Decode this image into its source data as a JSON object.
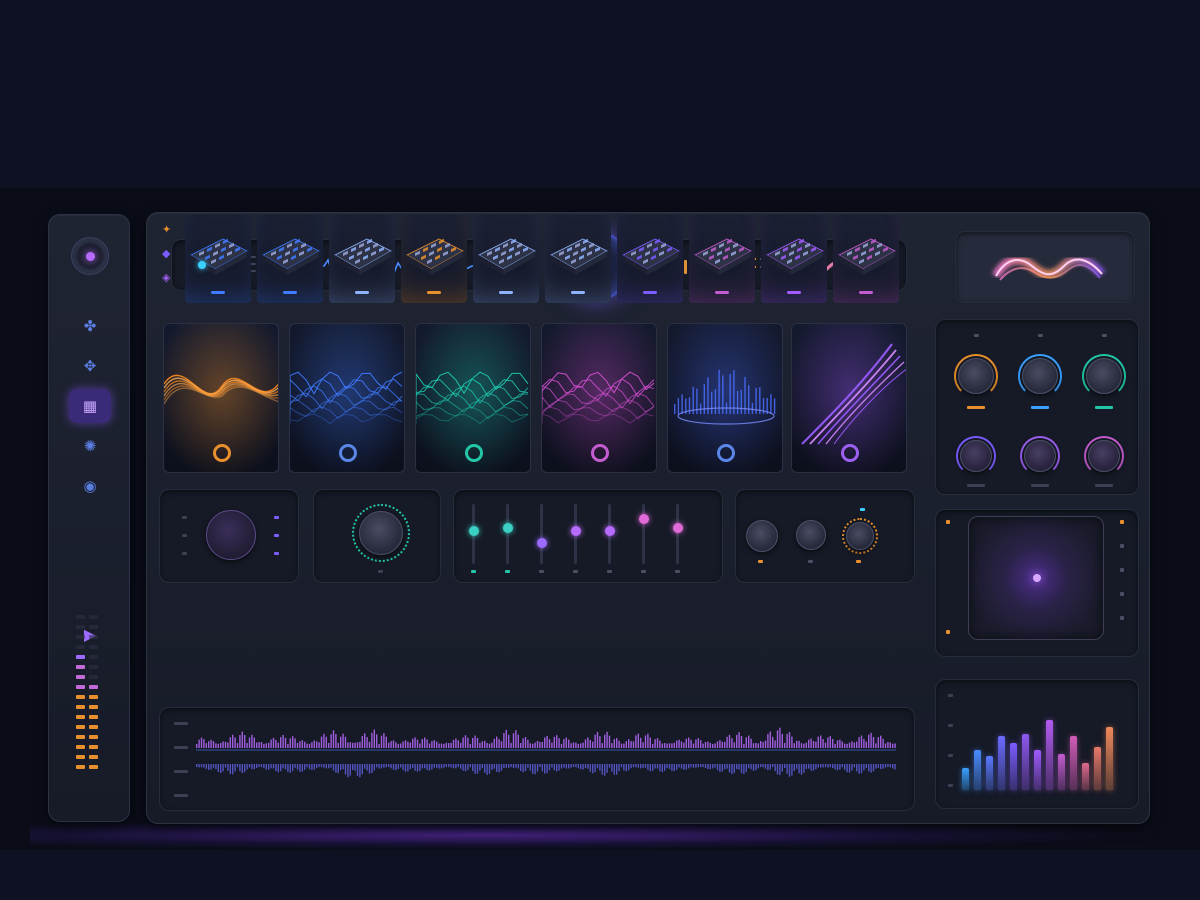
{
  "theme": {
    "background": "#0d1121",
    "panel": "#1c2030",
    "accent_purple": "#b86bff",
    "accent_orange": "#e89a3a",
    "accent_cyan": "#3ad0ff",
    "accent_blue": "#4a7bff"
  },
  "sidebar": {
    "icons": [
      "logo-icon",
      "nodes-icon",
      "nodes-alt-icon",
      "grid-icon",
      "gear-icon",
      "record-icon",
      "play-icon"
    ],
    "active_index": 3,
    "meter_levels": [
      0.75,
      0.55
    ]
  },
  "top_bar": {
    "modules": [
      "hexagon-icon",
      "waveform-display",
      "orb-indicator",
      "bars-icon",
      "curve-display"
    ]
  },
  "visualizers": [
    {
      "name": "orange-waves",
      "color": "#ff9a2e",
      "ring": "#e8902e"
    },
    {
      "name": "blue-terrain",
      "color": "#3f7bff",
      "ring": "#5a86e8"
    },
    {
      "name": "teal-terrain",
      "color": "#1fc9b0",
      "ring": "#23c7a8"
    },
    {
      "name": "magenta-mountains",
      "color": "#d24fd0",
      "ring": "#c35cd0"
    },
    {
      "name": "blue-spectrum",
      "color": "#4a6dff",
      "ring": "#5a86e8"
    },
    {
      "name": "purple-streaks",
      "color": "#a15bff",
      "ring": "#9c5ff0"
    }
  ],
  "controls": {
    "sliders": [
      {
        "level": 0.55,
        "color": "#3ad0c4"
      },
      {
        "level": 0.6,
        "color": "#3ad0c4"
      },
      {
        "level": 0.35,
        "color": "#9b6cff"
      },
      {
        "level": 0.55,
        "color": "#b86bff"
      },
      {
        "level": 0.55,
        "color": "#b86bff"
      },
      {
        "level": 0.75,
        "color": "#e06bd8"
      },
      {
        "level": 0.6,
        "color": "#e06bd8"
      }
    ]
  },
  "devices": [
    {
      "name": "blue-synth",
      "glow": "#3f7bff"
    },
    {
      "name": "blue-pad-controller",
      "glow": "#3f7bff"
    },
    {
      "name": "keyboard-white",
      "glow": "#8fb4ff"
    },
    {
      "name": "orange-groovebox",
      "glow": "#e8902e"
    },
    {
      "name": "keyboard-dark",
      "glow": "#8fb4ff"
    },
    {
      "name": "keyboard-light",
      "glow": "#8fb4ff"
    },
    {
      "name": "purple-pad",
      "glow": "#7b5cff"
    },
    {
      "name": "magenta-sequencer",
      "glow": "#c35cd0"
    },
    {
      "name": "violet-drum-machine",
      "glow": "#a15bff"
    },
    {
      "name": "pink-pad-controller",
      "glow": "#c35cd0"
    }
  ],
  "right_panel": {
    "knob_rings": [
      "#e8902e",
      "#3aa0ff",
      "#23c7a8",
      "#7b5cff",
      "#9c5ff0",
      "#c35cd0"
    ],
    "xy_position": [
      0.5,
      0.5
    ],
    "spectrum_levels": [
      0.25,
      0.45,
      0.38,
      0.6,
      0.52,
      0.62,
      0.45,
      0.78,
      0.4,
      0.6,
      0.3,
      0.48,
      0.7
    ],
    "spectrum_colors": [
      "#3aa0ff",
      "#4a8cff",
      "#5a7aff",
      "#6c6cff",
      "#7b5cff",
      "#8f58f0",
      "#a15bff",
      "#b35cf0",
      "#c35cd0",
      "#d25cb8",
      "#e06a8c",
      "#e87a6a",
      "#f0895a"
    ]
  },
  "timeline": {
    "track_colors": [
      "#b86bff",
      "#6c6cff"
    ]
  }
}
